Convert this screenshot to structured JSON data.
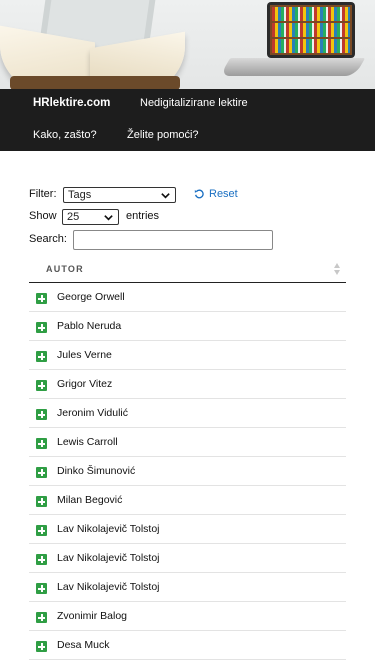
{
  "nav": {
    "brand": "HRlektire.com",
    "items": [
      "Nedigitalizirane lektire",
      "Kako, zašto?",
      "Želite pomoći?"
    ]
  },
  "filter": {
    "label": "Filter:",
    "selected": "Tags",
    "reset_label": "Reset"
  },
  "show": {
    "label": "Show",
    "selected": "25",
    "suffix": "entries"
  },
  "search": {
    "label": "Search:",
    "value": ""
  },
  "table": {
    "column": "AUTOR",
    "rows": [
      "George Orwell",
      "Pablo Neruda",
      "Jules Verne",
      "Grigor Vitez",
      "Jeronim Vidulić",
      "Lewis Carroll",
      "Dinko Šimunović",
      "Milan Begović",
      "Lav Nikolajevič Tolstoj",
      "Lav Nikolajevič Tolstoj",
      "Lav Nikolajevič Tolstoj",
      "Zvonimir Balog",
      "Desa Muck"
    ]
  },
  "colors": {
    "nav_bg": "#1d1d1d",
    "link": "#1a6fc2",
    "expand_green": "#2f9e44"
  },
  "icons": {
    "expand": "plus-square-icon",
    "reset": "refresh-icon",
    "sort": "sort-both-icon",
    "dropdown": "chevron-down-icon"
  }
}
